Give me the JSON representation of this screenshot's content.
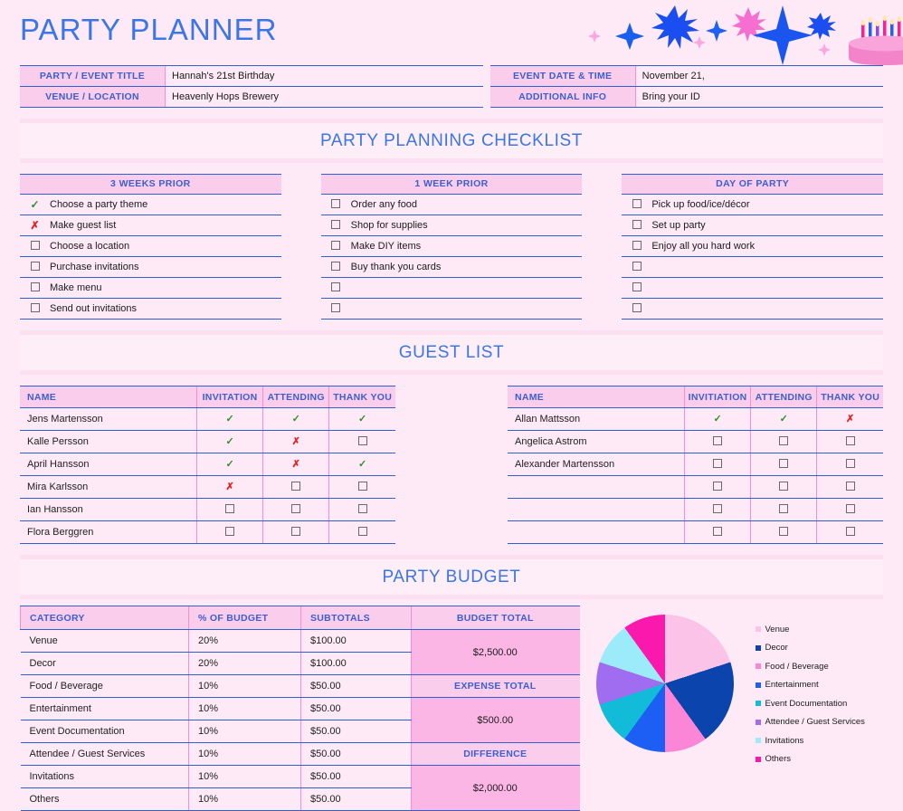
{
  "header": {
    "title": "PARTY PLANNER",
    "decor_icons": [
      "sparkle-icon",
      "star-burst-icon",
      "four-point-star-icon",
      "birthday-cake-icon"
    ]
  },
  "info": {
    "left_rows": [
      {
        "label": "PARTY / EVENT TITLE",
        "value": "Hannah's 21st Birthday"
      },
      {
        "label": "VENUE / LOCATION",
        "value": "Heavenly Hops Brewery"
      }
    ],
    "right_rows": [
      {
        "label": "EVENT DATE & TIME",
        "value": "November 21,"
      },
      {
        "label": "ADDITIONAL INFO",
        "value": "Bring your ID"
      }
    ]
  },
  "checklist": {
    "section_title": "PARTY PLANNING CHECKLIST",
    "columns": [
      {
        "heading": "3 WEEKS PRIOR",
        "items": [
          {
            "mark": "check",
            "text": "Choose a party theme"
          },
          {
            "mark": "x",
            "text": "Make guest list"
          },
          {
            "mark": "box",
            "text": "Choose a location"
          },
          {
            "mark": "box",
            "text": "Purchase invitations"
          },
          {
            "mark": "box",
            "text": "Make menu"
          },
          {
            "mark": "box",
            "text": "Send out invitations"
          }
        ]
      },
      {
        "heading": "1 WEEK PRIOR",
        "items": [
          {
            "mark": "box",
            "text": "Order any food"
          },
          {
            "mark": "box",
            "text": "Shop for supplies"
          },
          {
            "mark": "box",
            "text": "Make DIY items"
          },
          {
            "mark": "box",
            "text": "Buy thank you cards"
          },
          {
            "mark": "box",
            "text": ""
          },
          {
            "mark": "box",
            "text": ""
          }
        ]
      },
      {
        "heading": "DAY OF PARTY",
        "items": [
          {
            "mark": "box",
            "text": "Pick up food/ice/décor"
          },
          {
            "mark": "box",
            "text": "Set up party"
          },
          {
            "mark": "box",
            "text": "Enjoy all you hard work"
          },
          {
            "mark": "box",
            "text": ""
          },
          {
            "mark": "box",
            "text": ""
          },
          {
            "mark": "box",
            "text": ""
          }
        ]
      }
    ]
  },
  "guest_list": {
    "section_title": "GUEST LIST",
    "tables": [
      {
        "headers": [
          "NAME",
          "INVITATION",
          "ATTENDING",
          "THANK YOU"
        ],
        "rows": [
          {
            "name": "Jens Martensson",
            "invitation": "check",
            "attending": "check",
            "thank_you": "check"
          },
          {
            "name": "Kalle Persson",
            "invitation": "check",
            "attending": "x",
            "thank_you": "box"
          },
          {
            "name": "April Hansson",
            "invitation": "check",
            "attending": "x",
            "thank_you": "check"
          },
          {
            "name": "Mira Karlsson",
            "invitation": "x",
            "attending": "box",
            "thank_you": "box"
          },
          {
            "name": "Ian Hansson",
            "invitation": "box",
            "attending": "box",
            "thank_you": "box"
          },
          {
            "name": "Flora Berggren",
            "invitation": "box",
            "attending": "box",
            "thank_you": "box"
          }
        ]
      },
      {
        "headers": [
          "NAME",
          "INVITIATION",
          "ATTENDING",
          "THANK YOU"
        ],
        "rows": [
          {
            "name": "Allan Mattsson",
            "invitation": "check",
            "attending": "check",
            "thank_you": "x"
          },
          {
            "name": "Angelica Astrom",
            "invitation": "box",
            "attending": "box",
            "thank_you": "box"
          },
          {
            "name": "Alexander Martensson",
            "invitation": "box",
            "attending": "box",
            "thank_you": "box"
          },
          {
            "name": "",
            "invitation": "box",
            "attending": "box",
            "thank_you": "box"
          },
          {
            "name": "",
            "invitation": "box",
            "attending": "box",
            "thank_you": "box"
          },
          {
            "name": "",
            "invitation": "box",
            "attending": "box",
            "thank_you": "box"
          }
        ]
      }
    ]
  },
  "budget": {
    "section_title": "PARTY BUDGET",
    "headers": [
      "CATEGORY",
      "% OF BUDGET",
      "SUBTOTALS",
      "BUDGET TOTAL"
    ],
    "rows": [
      {
        "category": "Venue",
        "percent": "20%",
        "subtotal": "$100.00"
      },
      {
        "category": "Decor",
        "percent": "20%",
        "subtotal": "$100.00"
      },
      {
        "category": "Food / Beverage",
        "percent": "10%",
        "subtotal": "$50.00"
      },
      {
        "category": "Entertainment",
        "percent": "10%",
        "subtotal": "$50.00"
      },
      {
        "category": "Event Documentation",
        "percent": "10%",
        "subtotal": "$50.00"
      },
      {
        "category": "Attendee / Guest Services",
        "percent": "10%",
        "subtotal": "$50.00"
      },
      {
        "category": "Invitations",
        "percent": "10%",
        "subtotal": "$50.00"
      },
      {
        "category": "Others",
        "percent": "10%",
        "subtotal": "$50.00"
      }
    ],
    "totals": {
      "budget_total_value": "$2,500.00",
      "expense_total_label": "EXPENSE TOTAL",
      "expense_total_value": "$500.00",
      "difference_label": "DIFFERENCE",
      "difference_value": "$2,000.00"
    }
  },
  "chart_data": {
    "type": "pie",
    "title": "",
    "legend_position": "right",
    "categories": [
      "Venue",
      "Decor",
      "Food / Beverage",
      "Entertainment",
      "Event Documentation",
      "Attendee / Guest Services",
      "Invitations",
      "Others"
    ],
    "values": [
      20,
      20,
      10,
      10,
      10,
      10,
      10,
      10
    ],
    "unit": "percent of budget",
    "colors": [
      "#fcc3e8",
      "#0b44ad",
      "#fb85d7",
      "#1d5ef5",
      "#12bcd8",
      "#a06cf0",
      "#9cebfa",
      "#fa19ac"
    ]
  },
  "colors": {
    "page_background": "#fdeaf6",
    "band_background": "#fcdff1",
    "header_fill": "#fbcdec",
    "total_fill": "#fbb6e6",
    "accent_blue": "#3b76e8",
    "border_blue": "#2f5fd0",
    "border_pink": "#f48fd4",
    "check_green": "#2f8f2f",
    "x_red": "#e8201f"
  }
}
